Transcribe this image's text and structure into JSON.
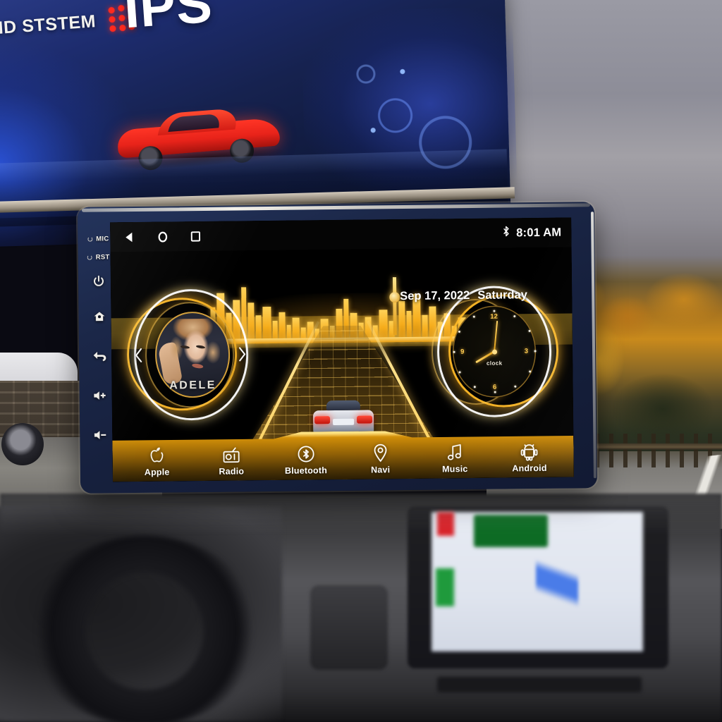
{
  "background": {
    "poster": {
      "headline": "ND STSTEM",
      "brand": "IPS",
      "dots_icon": "led-dot-matrix-icon",
      "car_icon": "red-sports-car-icon"
    },
    "scene": {
      "right_photo": "autumn-forest-road-photo",
      "left_photo": "white-car-roadside-photo",
      "bottom_photo": "car-dashboard-photo",
      "dash_nav_screen": "navigation-map-screen"
    }
  },
  "head_unit": {
    "bezel": {
      "mic_label": "MIC",
      "rst_label": "RST",
      "buttons": [
        {
          "name": "power-button",
          "icon": "power-icon"
        },
        {
          "name": "home-button",
          "icon": "home-icon"
        },
        {
          "name": "back-button",
          "icon": "back-arrow-icon"
        },
        {
          "name": "volume-up-button",
          "icon": "volume-up-icon"
        },
        {
          "name": "volume-down-button",
          "icon": "volume-down-icon"
        }
      ]
    },
    "statusbar": {
      "back_icon": "back-triangle-icon",
      "home_icon": "home-circle-icon",
      "recents_icon": "recents-square-icon",
      "bluetooth_icon": "bluetooth-icon",
      "time": "8:01 AM"
    },
    "home": {
      "date": "Sep 17, 2022",
      "weekday": "Saturday",
      "skyline_icon": "city-skyline-graphic",
      "road_icon": "perspective-road-grid-graphic",
      "car_icon": "silver-car-rear-graphic",
      "media": {
        "album_title": "ADELE",
        "album_art_icon": "album-cover-art",
        "prev_icon": "chevron-left-icon",
        "next_icon": "chevron-right-icon"
      },
      "clock": {
        "label": "clock",
        "numerals": [
          "12",
          "3",
          "6",
          "9"
        ],
        "hour_angle_deg": 240,
        "minute_angle_deg": 6
      }
    },
    "dock": [
      {
        "label": "Apple",
        "icon": "apple-icon"
      },
      {
        "label": "Radio",
        "icon": "radio-icon"
      },
      {
        "label": "Bluetooth",
        "icon": "bluetooth-icon"
      },
      {
        "label": "Navi",
        "icon": "location-pin-icon"
      },
      {
        "label": "Music",
        "icon": "music-note-icon"
      },
      {
        "label": "Android",
        "icon": "android-robot-icon"
      }
    ]
  },
  "colors": {
    "bezel": "#1b2748",
    "gold": "#f0a81a",
    "gold_light": "#ffd257",
    "screen_black": "#000000",
    "white": "#ffffff",
    "band_olive": "#5e4a12"
  }
}
